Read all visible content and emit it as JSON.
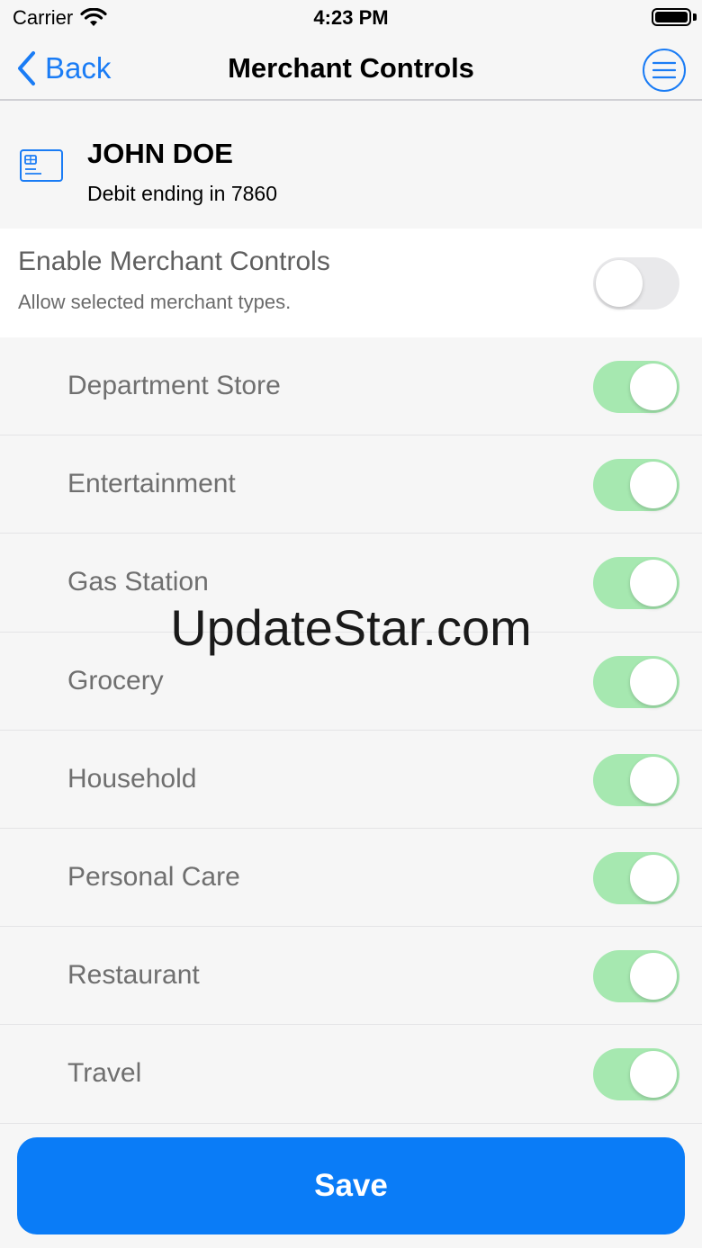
{
  "status_bar": {
    "carrier": "Carrier",
    "time": "4:23 PM"
  },
  "nav": {
    "back_label": "Back",
    "title": "Merchant Controls",
    "menu_icon": "menu-lines-icon"
  },
  "card": {
    "holder_name": "JOHN DOE",
    "description": "Debit ending in 7860",
    "icon": "card-icon"
  },
  "enable": {
    "title": "Enable Merchant Controls",
    "subtitle": "Allow selected merchant types.",
    "enabled": false
  },
  "merchants": [
    {
      "label": "Department Store",
      "enabled": true
    },
    {
      "label": "Entertainment",
      "enabled": true
    },
    {
      "label": "Gas Station",
      "enabled": true
    },
    {
      "label": "Grocery",
      "enabled": true
    },
    {
      "label": "Household",
      "enabled": true
    },
    {
      "label": "Personal Care",
      "enabled": true
    },
    {
      "label": "Restaurant",
      "enabled": true
    },
    {
      "label": "Travel",
      "enabled": true
    }
  ],
  "watermark": "UpdateStar.com",
  "save_label": "Save",
  "colors": {
    "accent": "#1a7cf5",
    "save_button": "#0a7cf7",
    "toggle_on": "#a6e8b0",
    "toggle_off": "#e9e9eb"
  }
}
